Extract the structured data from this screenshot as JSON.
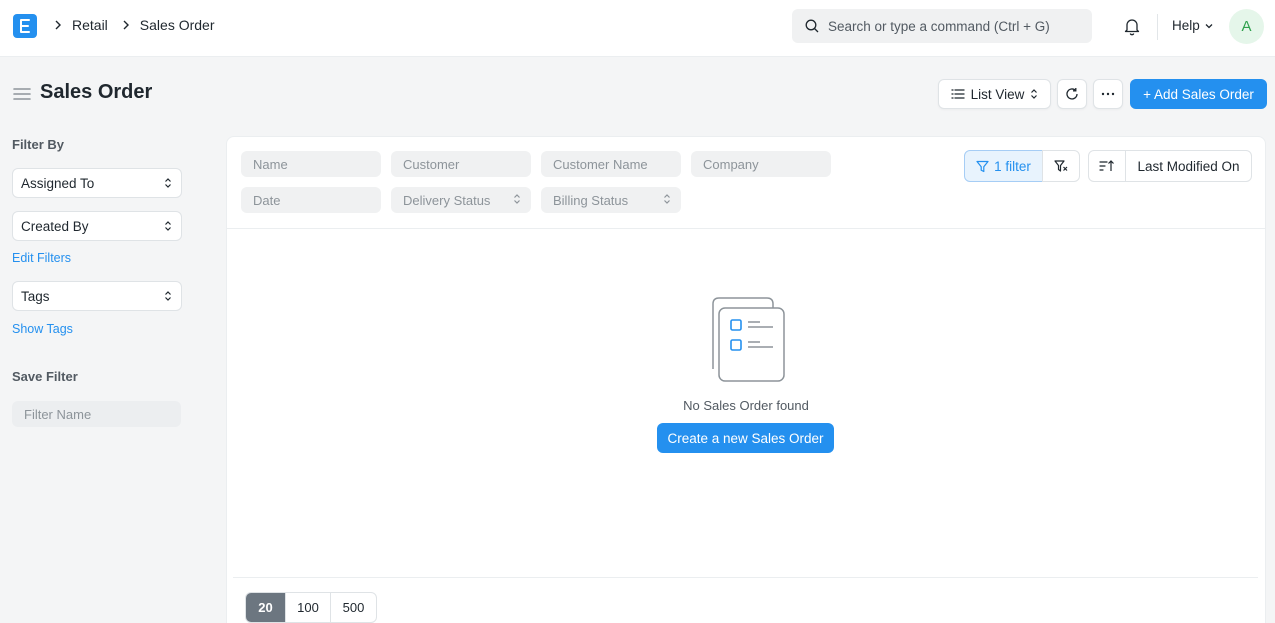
{
  "navbar": {
    "breadcrumbs": [
      "Retail",
      "Sales Order"
    ],
    "search_placeholder": "Search or type a command (Ctrl + G)",
    "help_label": "Help",
    "avatar_initial": "A"
  },
  "page": {
    "title": "Sales Order",
    "list_view_label": "List View",
    "add_button_label": "+ Add Sales Order"
  },
  "sidebar": {
    "filter_by_heading": "Filter By",
    "assigned_to": "Assigned To",
    "created_by": "Created By",
    "edit_filters": "Edit Filters",
    "tags": "Tags",
    "show_tags": "Show Tags",
    "save_filter_heading": "Save Filter",
    "filter_name_placeholder": "Filter Name"
  },
  "filters": {
    "name": "Name",
    "customer": "Customer",
    "customer_name": "Customer Name",
    "company": "Company",
    "date": "Date",
    "delivery_status": "Delivery Status",
    "billing_status": "Billing Status",
    "filter_count_label": "1 filter",
    "sort_by": "Last Modified On"
  },
  "empty_state": {
    "message": "No Sales Order found",
    "create_button": "Create a new Sales Order"
  },
  "paging": [
    "20",
    "100",
    "500"
  ],
  "colors": {
    "primary": "#2490ef",
    "background": "#f4f5f6",
    "active_page": "#6c7680"
  }
}
